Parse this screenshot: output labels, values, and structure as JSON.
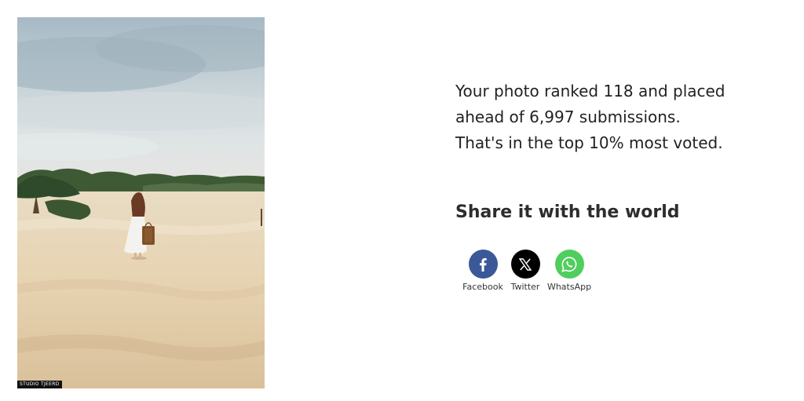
{
  "photo": {
    "watermark": "STUDIO TJEERD"
  },
  "result": {
    "line1": "Your photo ranked 118 and placed",
    "line2": "ahead of 6,997 submissions.",
    "line3": "That's in the top 10% most voted."
  },
  "share": {
    "title": "Share it with the world",
    "buttons": [
      {
        "label": "Facebook",
        "icon": "facebook-icon",
        "color": "#3b5998"
      },
      {
        "label": "Twitter",
        "icon": "x-icon",
        "color": "#000000"
      },
      {
        "label": "WhatsApp",
        "icon": "whatsapp-icon",
        "color": "#4fce5d"
      }
    ]
  }
}
